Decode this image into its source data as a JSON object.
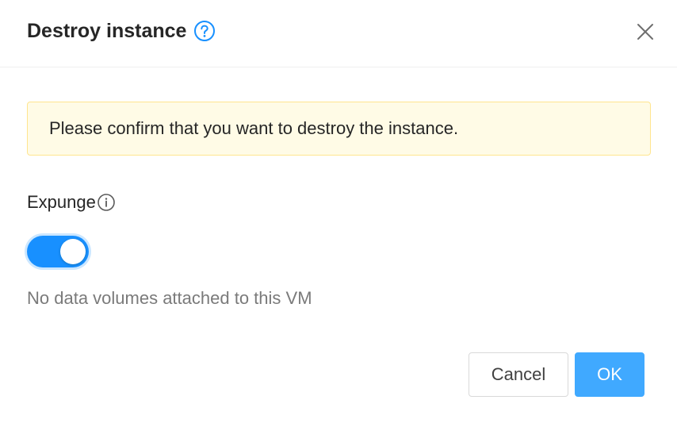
{
  "dialog": {
    "title": "Destroy instance",
    "help_icon": "question-circle-icon",
    "close_icon": "close-icon"
  },
  "alert": {
    "message": "Please confirm that you want to destroy the instance.",
    "background": "#fffbe6",
    "border": "#ffe58f"
  },
  "form": {
    "expunge_label": "Expunge",
    "expunge_info_icon": "info-circle-icon",
    "expunge_checked": true,
    "note": "No data volumes attached to this VM"
  },
  "footer": {
    "cancel_label": "Cancel",
    "ok_label": "OK"
  },
  "colors": {
    "accent": "#1890ff",
    "ok_button": "#40a9ff"
  }
}
